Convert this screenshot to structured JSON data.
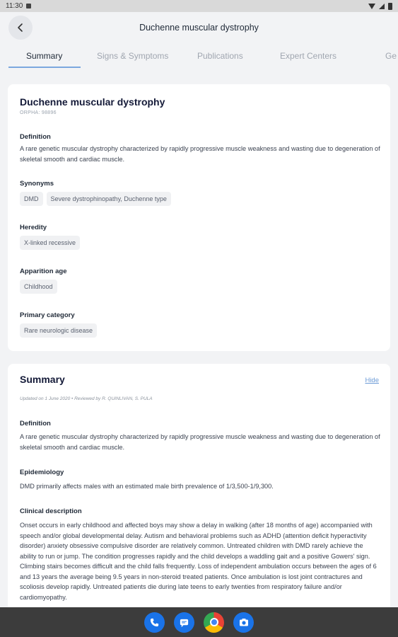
{
  "status_bar": {
    "time": "11:30"
  },
  "app_bar": {
    "title": "Duchenne muscular dystrophy"
  },
  "tabs": [
    {
      "label": "Summary"
    },
    {
      "label": "Signs & Symptoms"
    },
    {
      "label": "Publications"
    },
    {
      "label": "Expert Centers"
    },
    {
      "label": "Ge"
    }
  ],
  "overview": {
    "name": "Duchenne muscular dystrophy",
    "orpha": "ORPHA: 98896",
    "definition_label": "Definition",
    "definition_text": "A rare genetic muscular dystrophy characterized by rapidly progressive muscle weakness and wasting due to degeneration of skeletal smooth and cardiac muscle.",
    "synonyms_label": "Synonyms",
    "synonyms": [
      "DMD",
      "Severe dystrophinopathy, Duchenne type"
    ],
    "heredity_label": "Heredity",
    "heredity": [
      "X-linked recessive"
    ],
    "apparition_label": "Apparition age",
    "apparition": [
      "Childhood"
    ],
    "category_label": "Primary category",
    "category": [
      "Rare neurologic disease"
    ]
  },
  "summary": {
    "title": "Summary",
    "hide_label": "Hide",
    "meta": "Updated on 1 June 2020  •  Reviewed by R. QUINLIVAN, S. PULA",
    "definition_label": "Definition",
    "definition_text": "A rare genetic muscular dystrophy characterized by rapidly progressive muscle weakness and wasting due to degeneration of skeletal smooth and cardiac muscle.",
    "epidemiology_label": "Epidemiology",
    "epidemiology_text": "DMD primarily affects males with an estimated male birth prevalence of 1/3,500-1/9,300.",
    "clinical_label": "Clinical description",
    "clinical_text": "Onset occurs in early childhood and affected boys may show a delay in walking (after 18 months of age) accompanied with speech and/or global developmental delay. Autism and behavioral problems such as ADHD (attention deficit hyperactivity disorder) anxiety obsessive compulsive disorder are relatively common. Untreated children with DMD rarely achieve the ability to run or jump. The condition progresses rapidly and the child develops a waddling gait and a positive Gowers' sign. Climbing stairs becomes difficult and the child falls frequently. Loss of independent ambulation occurs between the ages of 6 and 13 years the average being 9.5 years in non-steroid treated patients. Once ambulation is lost joint contractures and scoliosis develop rapidly. Untreated patients die during late teens to early twenties from respiratory failure and/or cardiomyopathy."
  },
  "nav_bar": {
    "icons": [
      "phone-icon",
      "messages-icon",
      "chrome-icon",
      "camera-icon"
    ]
  }
}
